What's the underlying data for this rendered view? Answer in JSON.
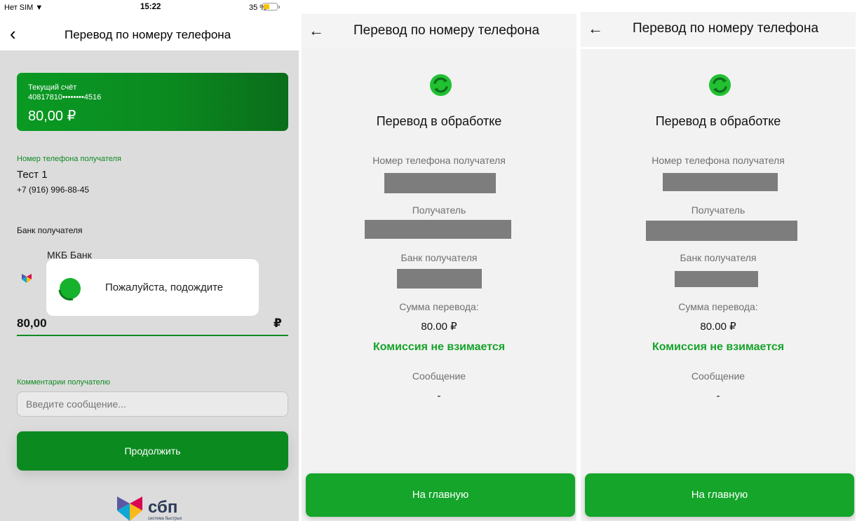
{
  "panel1": {
    "status": {
      "carrier": "Нет SIM",
      "time": "15:22",
      "battery": "35 %"
    },
    "nav": {
      "title": "Перевод по номеру телефона"
    },
    "account": {
      "name": "Текущий счёт",
      "number": "40817810••••••••4516",
      "balance": "80,00 ₽"
    },
    "recipient": {
      "label": "Номер телефона получателя",
      "name": "Тест 1",
      "phone": "+7 (916) 996-88-45"
    },
    "bank": {
      "label": "Банк получателя",
      "name": "МКБ Банк"
    },
    "amount": {
      "value": "80,00",
      "currency": "₽"
    },
    "comment": {
      "label": "Комментарии получателю",
      "placeholder": "Введите сообщение..."
    },
    "continue_label": "Продолжить",
    "loading": {
      "message": "Пожалуйста, подождите"
    },
    "sbp": {
      "word": "сбп",
      "subtitle": "система быстрых"
    }
  },
  "android": {
    "title": "Перевод по номеру телефона",
    "status_title": "Перевод в обработке",
    "phone_label": "Номер телефона получателя",
    "recipient_label": "Получатель",
    "bank_label": "Банк получателя",
    "amount_label": "Сумма перевода:",
    "amount_value": "80.00 ₽",
    "fee_text": "Комиссия не взимается",
    "message_label": "Сообщение",
    "message_value": "-",
    "home_label": "На главную"
  },
  "colors": {
    "brand_green": "#0b8a20",
    "button_green": "#14a52a",
    "icon_green": "#21c132",
    "label_green": "#118a25"
  }
}
